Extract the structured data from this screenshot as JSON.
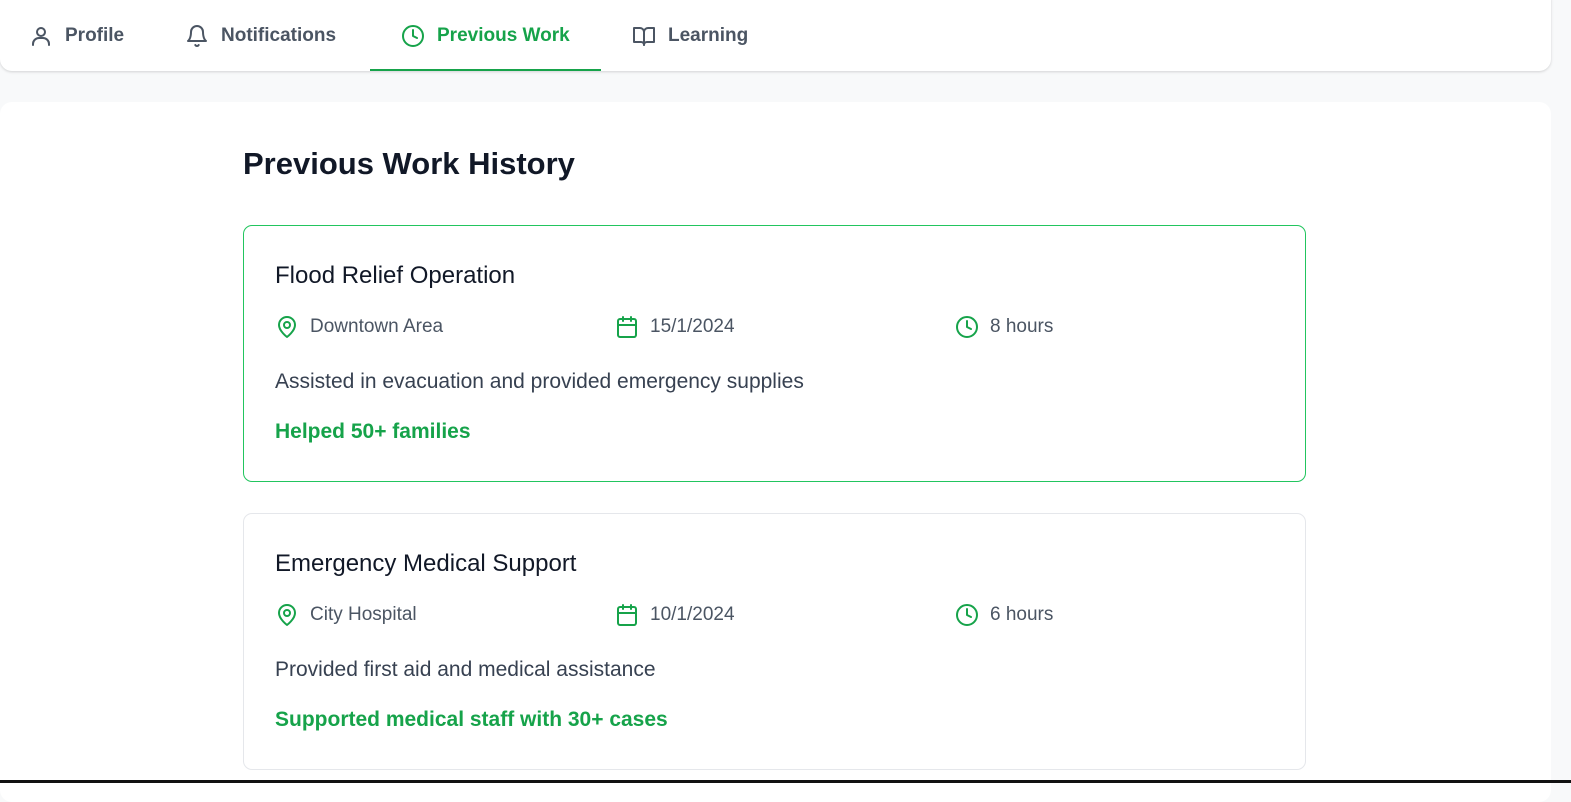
{
  "tabs": [
    {
      "label": "Profile",
      "icon": "user-icon"
    },
    {
      "label": "Notifications",
      "icon": "bell-icon"
    },
    {
      "label": "Previous Work",
      "icon": "clock-icon",
      "active": true
    },
    {
      "label": "Learning",
      "icon": "book-icon"
    }
  ],
  "page": {
    "title": "Previous Work History"
  },
  "accent_color": "#16a34a",
  "work": [
    {
      "title": "Flood Relief Operation",
      "location": "Downtown Area",
      "date": "15/1/2024",
      "duration": "8 hours",
      "description": "Assisted in evacuation and provided emergency supplies",
      "impact": "Helped 50+ families"
    },
    {
      "title": "Emergency Medical Support",
      "location": "City Hospital",
      "date": "10/1/2024",
      "duration": "6 hours",
      "description": "Provided first aid and medical assistance",
      "impact": "Supported medical staff with 30+ cases"
    }
  ]
}
